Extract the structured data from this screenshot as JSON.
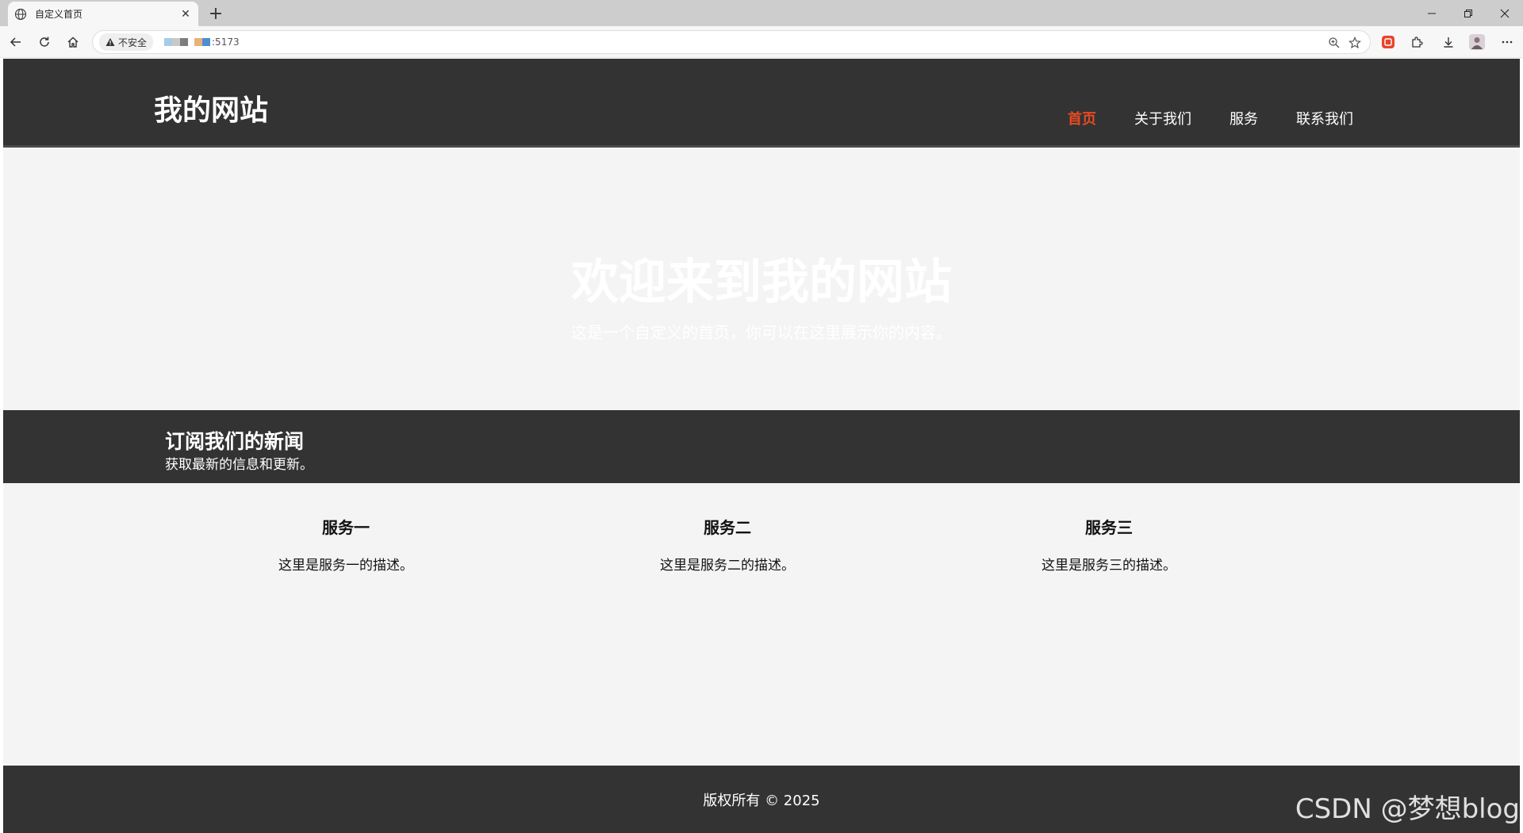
{
  "browser": {
    "tab_title": "自定义首页",
    "new_tab_symbol": "+",
    "close_symbol": "✕",
    "security_label": "不安全",
    "url_port": ":5173",
    "host_blur_colors": [
      "#a8cbe6",
      "#c9c9c9",
      "#7d7d7d",
      "#e9b27a",
      "#4b8fd1"
    ]
  },
  "site": {
    "logo": "我的网站",
    "nav": [
      {
        "label": "首页",
        "active": true
      },
      {
        "label": "关于我们",
        "active": false
      },
      {
        "label": "服务",
        "active": false
      },
      {
        "label": "联系我们",
        "active": false
      }
    ],
    "hero": {
      "title": "欢迎来到我的网站",
      "subtitle": "这是一个自定义的首页，你可以在这里展示你的内容。"
    },
    "newsletter": {
      "title": "订阅我们的新闻",
      "subtitle": "获取最新的信息和更新。"
    },
    "services": [
      {
        "title": "服务一",
        "description": "这里是服务一的描述。"
      },
      {
        "title": "服务二",
        "description": "这里是服务二的描述。"
      },
      {
        "title": "服务三",
        "description": "这里是服务三的描述。"
      }
    ],
    "footer": {
      "copyright": "版权所有 © 2025"
    }
  },
  "watermark": "CSDN @梦想blog",
  "colors": {
    "header_bg": "#333333",
    "page_bg": "#f4f4f4",
    "nav_active": "#e84a22"
  }
}
